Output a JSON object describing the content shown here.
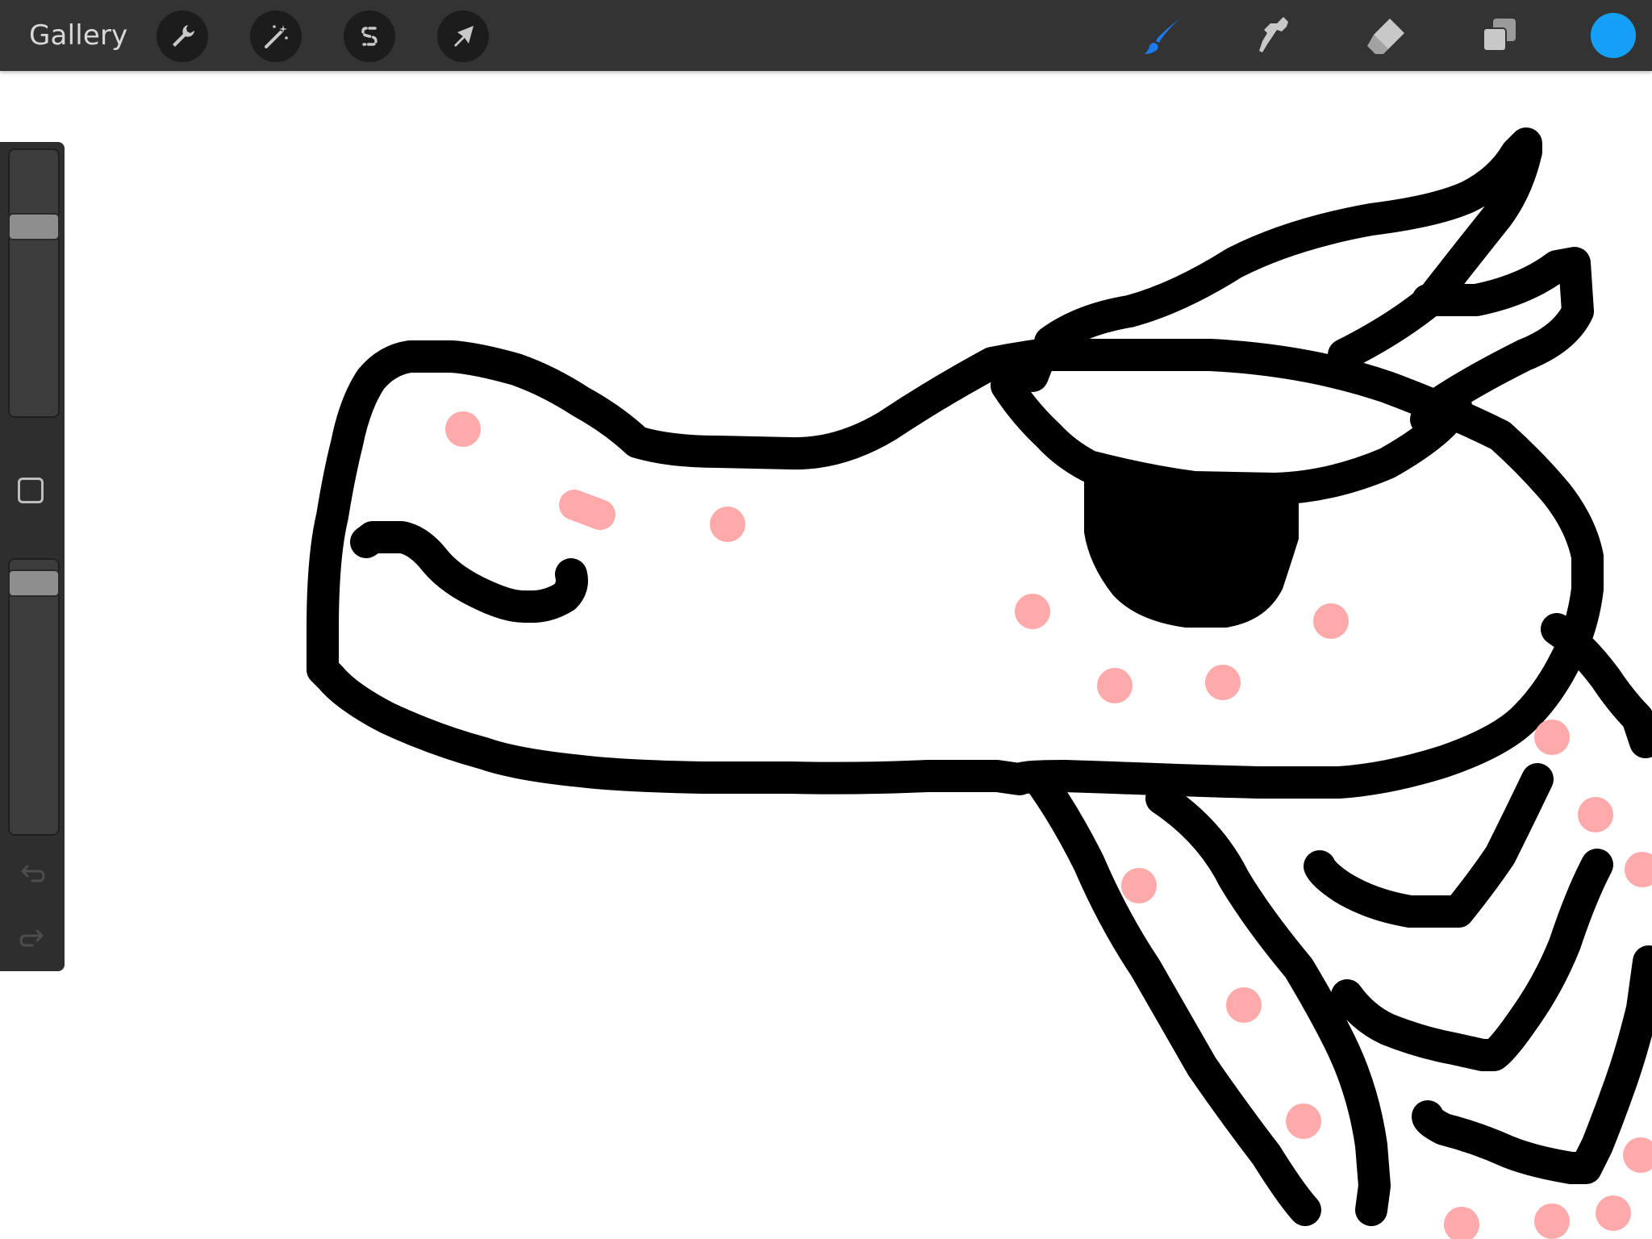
{
  "toolbar": {
    "gallery_label": "Gallery",
    "left_tools": [
      {
        "name": "actions",
        "icon": "wrench-icon"
      },
      {
        "name": "adjustments",
        "icon": "magic-wand-icon"
      },
      {
        "name": "selection",
        "icon": "selection-s-icon"
      },
      {
        "name": "transform",
        "icon": "arrow-cursor-icon"
      }
    ],
    "right_tools": [
      {
        "name": "brush",
        "icon": "brush-icon",
        "active": true
      },
      {
        "name": "smudge",
        "icon": "smudge-finger-icon",
        "active": false
      },
      {
        "name": "eraser",
        "icon": "eraser-icon",
        "active": false
      },
      {
        "name": "layers",
        "icon": "layers-icon",
        "active": false
      }
    ],
    "current_color": "#14a0f6",
    "accent_color": "#1a7cf0"
  },
  "sidebar": {
    "brush_size_level": 0.74,
    "opacity_level": 0.96,
    "modify_icon": "square-modify-icon",
    "undo_icon": "undo-arrow-icon",
    "redo_icon": "redo-arrow-icon"
  },
  "canvas": {
    "stroke_color": "#000000",
    "spot_color": "#ffaaaa",
    "background": "#ffffff"
  }
}
